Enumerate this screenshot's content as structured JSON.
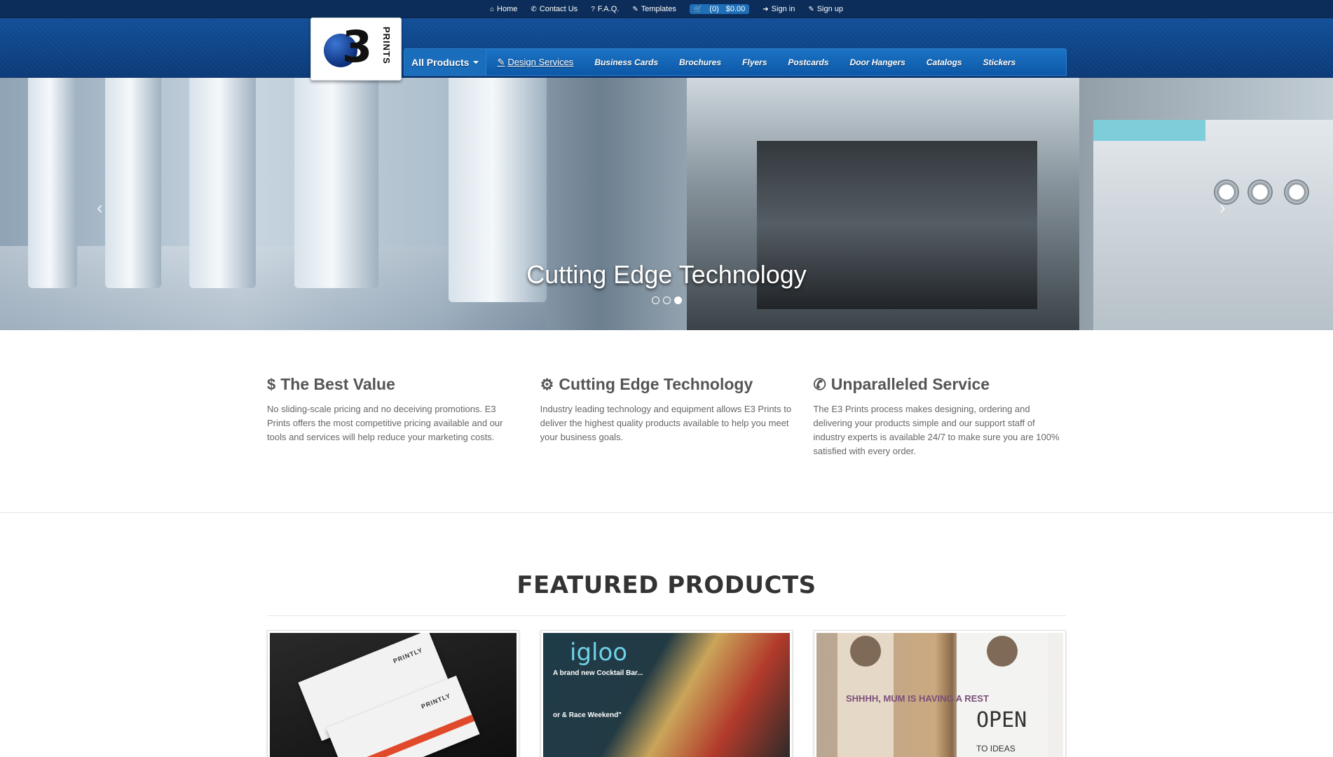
{
  "topbar": {
    "links": [
      {
        "icon": "home-icon",
        "glyph": "⌂",
        "label": "Home"
      },
      {
        "icon": "phone-icon",
        "glyph": "✆",
        "label": "Contact Us"
      },
      {
        "icon": "question-icon",
        "glyph": "?",
        "label": "F.A.Q."
      },
      {
        "icon": "pencil-icon",
        "glyph": "✎",
        "label": "Templates"
      }
    ],
    "cart": {
      "count": "(0)",
      "total": "$0.00"
    },
    "signin": "Sign in",
    "signup": "Sign up"
  },
  "logo": {
    "mark": "3",
    "text": "PRINTS"
  },
  "nav": {
    "primary": "All Products",
    "design": "Design Services",
    "items": [
      "Business Cards",
      "Brochures",
      "Flyers",
      "Postcards",
      "Door Hangers",
      "Catalogs",
      "Stickers"
    ]
  },
  "hero": {
    "caption": "Cutting Edge Technology",
    "prev": "‹",
    "next": "›",
    "slides": 3,
    "active_slide": 3
  },
  "features": [
    {
      "icon": "dollar-icon",
      "glyph": "$",
      "title": "The Best Value",
      "text": "No sliding-scale pricing and no deceiving promotions. E3 Prints offers the most competitive pricing available and our tools and services will help reduce your marketing costs."
    },
    {
      "icon": "gears-icon",
      "glyph": "⚙",
      "title": "Cutting Edge Technology",
      "text": "Industry leading technology and equipment allows E3 Prints to deliver the highest quality products available to help you meet your business goals."
    },
    {
      "icon": "phone-icon",
      "glyph": "✆",
      "title": "Unparalleled Service",
      "text": "The E3 Prints process makes designing, ordering and delivering your products simple and our support staff of industry experts is available 24/7 to make sure you are 100% satisfied with every order."
    }
  ],
  "featured": {
    "title": "FEATURED PRODUCTS",
    "products": [
      {
        "brand": "PRINTLY"
      },
      {
        "headline": "igloo",
        "tag1": "A brand new Cocktail Bar...",
        "tag2": "or & Race Weekend\""
      },
      {
        "text1": "SHHHH, MUM IS HAVING A REST",
        "text2": "OPEN",
        "text3": "TO IDEAS"
      }
    ]
  },
  "colors": {
    "topbar": "#0c2d59",
    "header": "#0f4d96",
    "nav": "#1c73c4",
    "text": "#555555"
  }
}
